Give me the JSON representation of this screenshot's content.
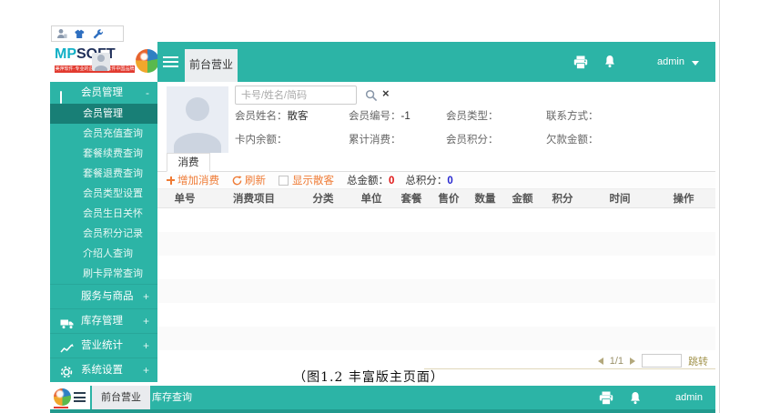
{
  "colors": {
    "teal": "#2cb4a6",
    "teal_active": "#187f76",
    "orange": "#ef7b35",
    "red": "#e01414",
    "blue": "#2626cf",
    "logo_red": "#e23b30"
  },
  "logo": {
    "mp": "MP",
    "soft": "SOFT",
    "tagline": "美萍软件·专业的企业管理软件中国品牌"
  },
  "topbar": {
    "tab_label": "前台营业",
    "user": "admin"
  },
  "sidebar": {
    "groups": [
      {
        "label": "会员管理",
        "toggle": "-",
        "icon": "credit-card-icon",
        "items": [
          "会员管理",
          "会员充值查询",
          "套餐续费查询",
          "套餐退费查询",
          "会员类型设置",
          "会员生日关怀",
          "会员积分记录",
          "介绍人查询",
          "刷卡异常查询"
        ],
        "active_item": "会员管理"
      },
      {
        "label": "服务与商品",
        "toggle": "+",
        "icon": "list-icon"
      },
      {
        "label": "库存管理",
        "toggle": "+",
        "icon": "truck-icon"
      },
      {
        "label": "营业统计",
        "toggle": "+",
        "icon": "chart-icon"
      },
      {
        "label": "系统设置",
        "toggle": "+",
        "icon": "gear-icon"
      }
    ]
  },
  "member_panel": {
    "search_placeholder": "卡号/姓名/简码",
    "fields": [
      {
        "label": "会员姓名：",
        "value": "散客"
      },
      {
        "label": "会员编号：",
        "value": "-1"
      },
      {
        "label": "会员类型：",
        "value": ""
      },
      {
        "label": "联系方式：",
        "value": ""
      },
      {
        "label": "卡内余额：",
        "value": ""
      },
      {
        "label": "累计消费：",
        "value": ""
      },
      {
        "label": "会员积分：",
        "value": ""
      },
      {
        "label": "欠款金额：",
        "value": ""
      }
    ]
  },
  "consumption": {
    "tab_label": "消费",
    "toolbar": {
      "add_label": "增加消费",
      "refresh_label": "刷新",
      "show_walkin_label": "显示散客",
      "total_amount_label": "总金额：",
      "total_amount": "0",
      "total_points_label": "总积分：",
      "total_points": "0"
    },
    "table_headers": [
      "单号",
      "消费项目",
      "分类",
      "单位",
      "套餐",
      "售价",
      "数量",
      "金额",
      "积分",
      "时间",
      "操作"
    ],
    "pagination": {
      "page": "1/1",
      "jump_label": "跳转",
      "jump_value": ""
    }
  },
  "caption": "（图1.2 丰富版主页面）",
  "bottom_bar": {
    "tabs": [
      {
        "label": "前台营业"
      },
      {
        "label": "库存查询"
      }
    ],
    "user": "admin"
  }
}
